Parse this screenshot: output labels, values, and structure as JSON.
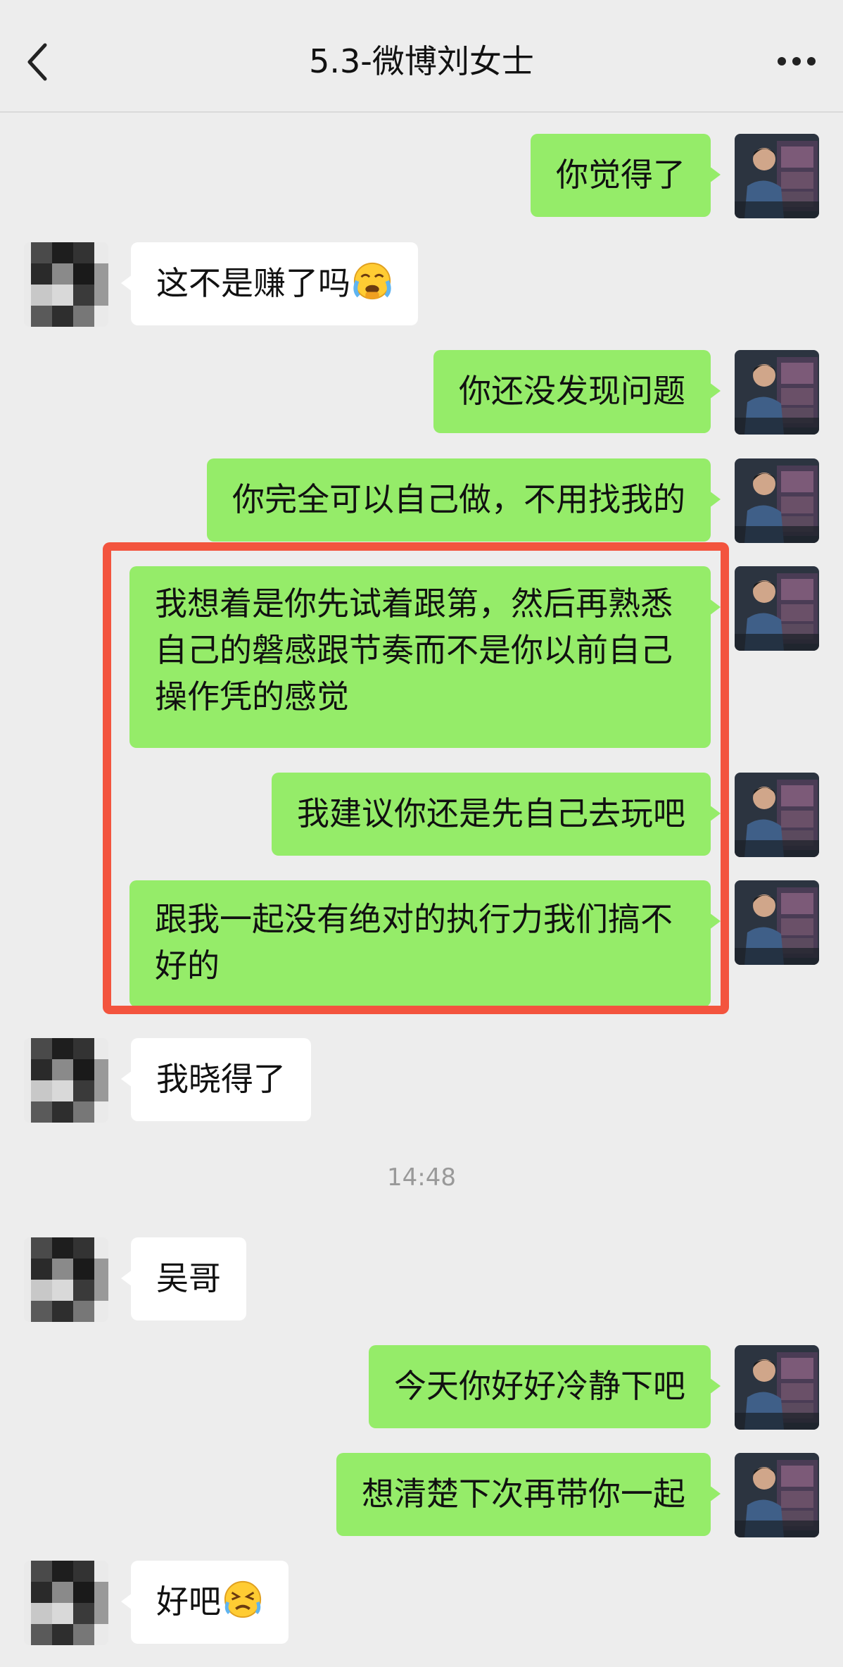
{
  "header": {
    "title": "5.3-微博刘女士",
    "back_icon": "chevron-left-icon",
    "more_icon": "more-dots-icon"
  },
  "messages": [
    {
      "side": "me",
      "text": "你觉得了"
    },
    {
      "side": "other",
      "text": "这不是赚了吗",
      "emoji": "face-with-tears-emoji"
    },
    {
      "side": "me",
      "text": "你还没发现问题"
    },
    {
      "side": "me",
      "text": "你完全可以自己做，不用找我的"
    },
    {
      "side": "me",
      "text": "我想着是你先试着跟第，然后再熟悉自己的磐感跟节奏而不是你以前自己操作凭的感觉"
    },
    {
      "side": "me",
      "text": "我建议你还是先自己去玩吧"
    },
    {
      "side": "me",
      "text": "跟我一起没有绝对的执行力我们搞不好的"
    },
    {
      "side": "other",
      "text": "我晓得了"
    },
    {
      "side": "other",
      "text": "吴哥"
    },
    {
      "side": "me",
      "text": "今天你好好冷静下吧"
    },
    {
      "side": "me",
      "text": "想清楚下次再带你一起"
    },
    {
      "side": "other",
      "text": "好吧",
      "emoji": "tired-face-emoji"
    }
  ],
  "timestamp": "14:48",
  "colors": {
    "background": "#ededed",
    "my_bubble": "#95ec69",
    "their_bubble": "#ffffff",
    "highlight_border": "#f3543e"
  }
}
